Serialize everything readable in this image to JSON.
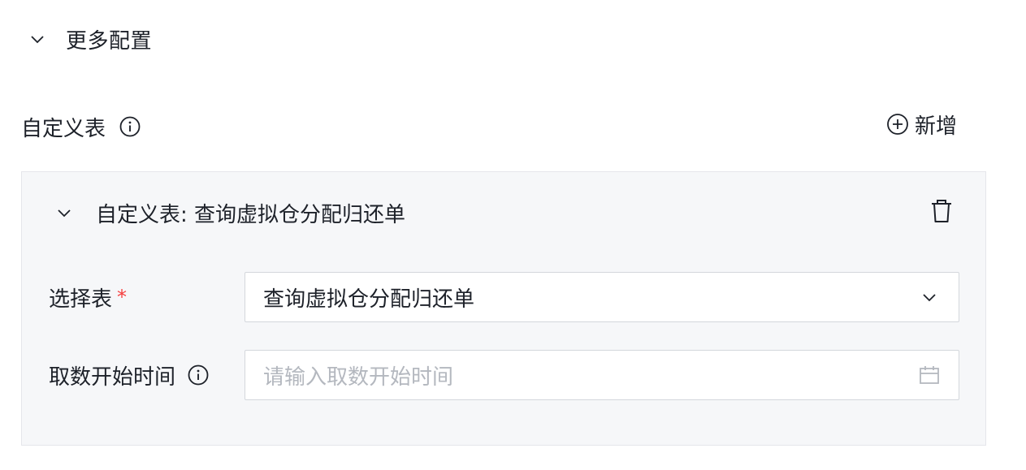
{
  "more_config": {
    "title": "更多配置",
    "chevron_icon": "chevron-down-icon"
  },
  "custom_table": {
    "title": "自定义表",
    "info_icon": "info-circle-icon",
    "add_label": "新增",
    "add_icon": "plus-circle-icon"
  },
  "panel": {
    "title": "自定义表: 查询虚拟仓分配归还单",
    "delete_icon": "trash-icon",
    "fields": {
      "select_table": {
        "label": "选择表",
        "required_mark": "*",
        "value": "查询虚拟仓分配归还单",
        "icon": "chevron-down-icon"
      },
      "start_time": {
        "label": "取数开始时间",
        "placeholder": "请输入取数开始时间",
        "icon": "calendar-icon"
      }
    }
  },
  "colors": {
    "text": "#1d2129",
    "placeholder": "#b4b8bf",
    "required": "#f53f3f",
    "panel_bg": "#f6f7f9",
    "border": "#d4d7dc"
  }
}
